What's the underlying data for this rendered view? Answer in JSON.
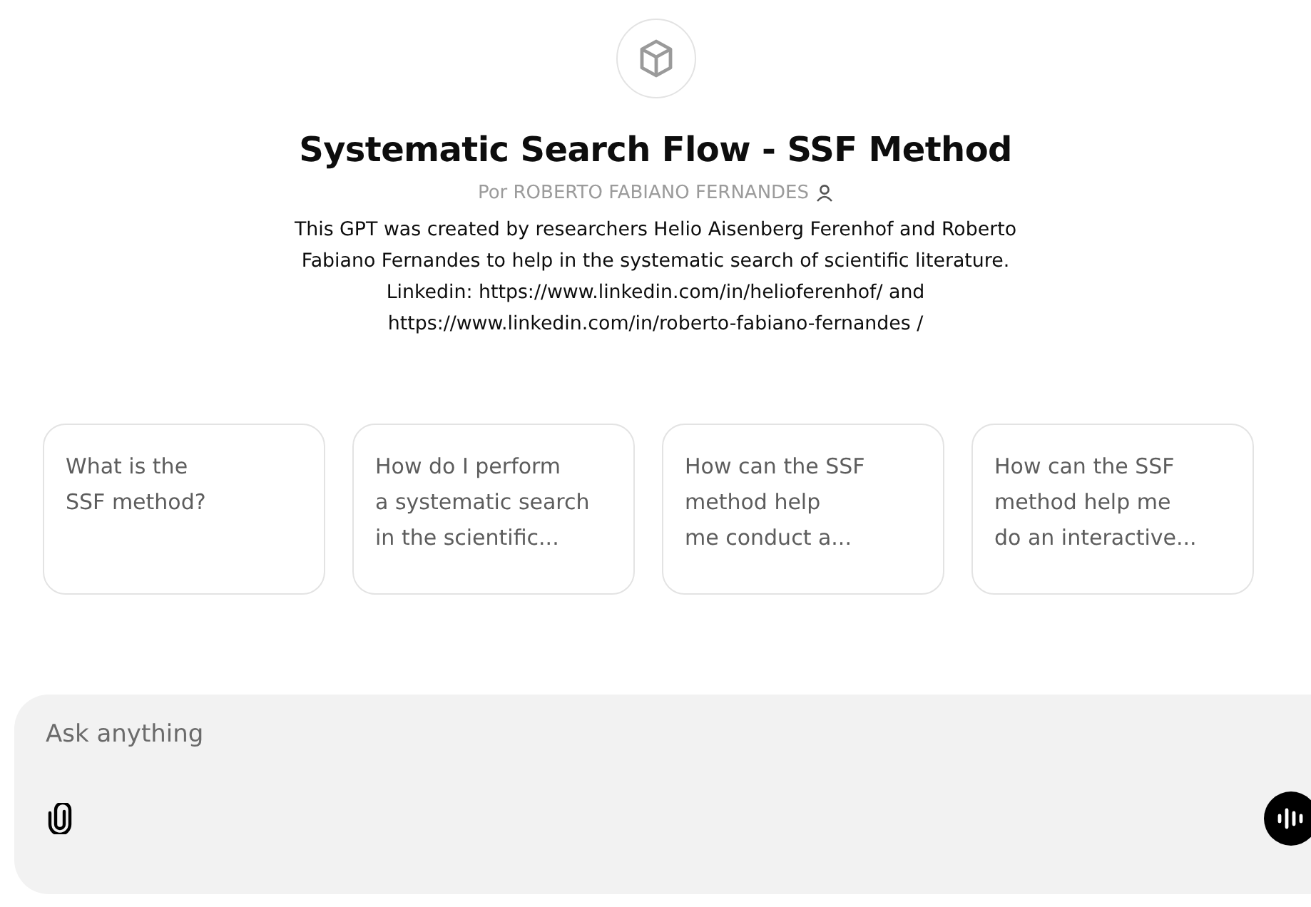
{
  "title": "Systematic Search Flow - SSF Method",
  "author": "Por ROBERTO FABIANO FERNANDES",
  "description": "This GPT was created by researchers Helio Aisenberg Ferenhof and Roberto Fabiano Fernandes to help in the systematic search of scientific literature. Linkedin: https://www.linkedin.com/in/helioferenhof/ and https://www.linkedin.com/in/roberto-fabiano-fernandes /",
  "suggestions": [
    {
      "lines": [
        "What is the",
        "SSF method?"
      ]
    },
    {
      "lines": [
        "How do I perform",
        "a systematic search",
        "in the scientific..."
      ]
    },
    {
      "lines": [
        "How can the SSF",
        "method help",
        "me conduct a..."
      ]
    },
    {
      "lines": [
        "How can the SSF",
        "method help me",
        "do an interactive..."
      ]
    }
  ],
  "composer": {
    "placeholder": "Ask anything"
  }
}
